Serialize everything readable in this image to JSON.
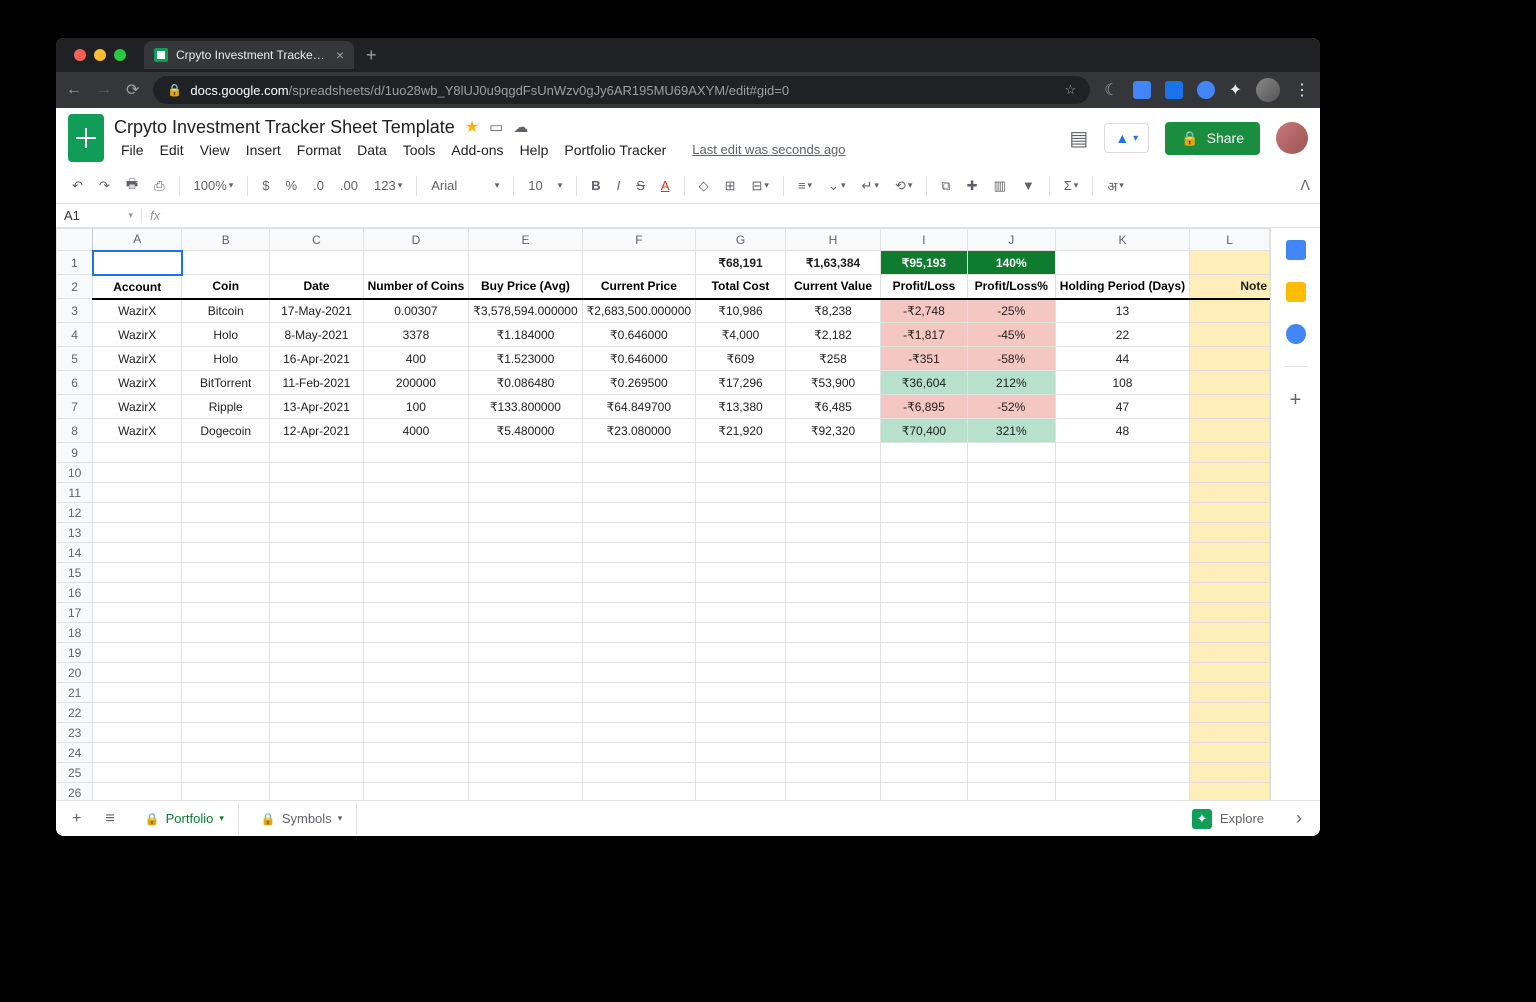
{
  "browser": {
    "tab_title": "Crpyto Investment Tracker She",
    "url_prefix": "docs.google.com",
    "url_rest": "/spreadsheets/d/1uo28wb_Y8lUJ0u9qgdFsUnWzv0gJy6AR195MU69AXYM/edit#gid=0"
  },
  "doc": {
    "title": "Crpyto Investment Tracker Sheet Template",
    "last_edit": "Last edit was seconds ago",
    "share": "Share"
  },
  "menu": [
    "File",
    "Edit",
    "View",
    "Insert",
    "Format",
    "Data",
    "Tools",
    "Add-ons",
    "Help",
    "Portfolio Tracker"
  ],
  "toolbar": {
    "zoom": "100%",
    "font": "Arial",
    "size": "10"
  },
  "namebox": "A1",
  "cols": [
    "A",
    "B",
    "C",
    "D",
    "E",
    "F",
    "G",
    "H",
    "I",
    "J",
    "K",
    "L"
  ],
  "summary": {
    "g": "₹68,191",
    "h": "₹1,63,384",
    "i": "₹95,193",
    "j": "140%"
  },
  "headers": [
    "Account",
    "Coin",
    "Date",
    "Number of Coins",
    "Buy Price (Avg)",
    "Current Price",
    "Total Cost",
    "Current Value",
    "Profit/Loss",
    "Profit/Loss%",
    "Holding Period (Days)",
    "Note"
  ],
  "rows": [
    {
      "a": "WazirX",
      "b": "Bitcoin",
      "c": "17-May-2021",
      "d": "0.00307",
      "e": "₹3,578,594.000000",
      "f": "₹2,683,500.000000",
      "g": "₹10,986",
      "h": "₹8,238",
      "i": "-₹2,748",
      "j": "-25%",
      "k": "13",
      "pl": "loss"
    },
    {
      "a": "WazirX",
      "b": "Holo",
      "c": "8-May-2021",
      "d": "3378",
      "e": "₹1.184000",
      "f": "₹0.646000",
      "g": "₹4,000",
      "h": "₹2,182",
      "i": "-₹1,817",
      "j": "-45%",
      "k": "22",
      "pl": "loss"
    },
    {
      "a": "WazirX",
      "b": "Holo",
      "c": "16-Apr-2021",
      "d": "400",
      "e": "₹1.523000",
      "f": "₹0.646000",
      "g": "₹609",
      "h": "₹258",
      "i": "-₹351",
      "j": "-58%",
      "k": "44",
      "pl": "loss"
    },
    {
      "a": "WazirX",
      "b": "BitTorrent",
      "c": "11-Feb-2021",
      "d": "200000",
      "e": "₹0.086480",
      "f": "₹0.269500",
      "g": "₹17,296",
      "h": "₹53,900",
      "i": "₹36,604",
      "j": "212%",
      "k": "108",
      "pl": "gain"
    },
    {
      "a": "WazirX",
      "b": "Ripple",
      "c": "13-Apr-2021",
      "d": "100",
      "e": "₹133.800000",
      "f": "₹64.849700",
      "g": "₹13,380",
      "h": "₹6,485",
      "i": "-₹6,895",
      "j": "-52%",
      "k": "47",
      "pl": "loss"
    },
    {
      "a": "WazirX",
      "b": "Dogecoin",
      "c": "12-Apr-2021",
      "d": "4000",
      "e": "₹5.480000",
      "f": "₹23.080000",
      "g": "₹21,920",
      "h": "₹92,320",
      "i": "₹70,400",
      "j": "321%",
      "k": "48",
      "pl": "gain"
    }
  ],
  "tabs": {
    "portfolio": "Portfolio",
    "symbols": "Symbols"
  },
  "explore": "Explore"
}
